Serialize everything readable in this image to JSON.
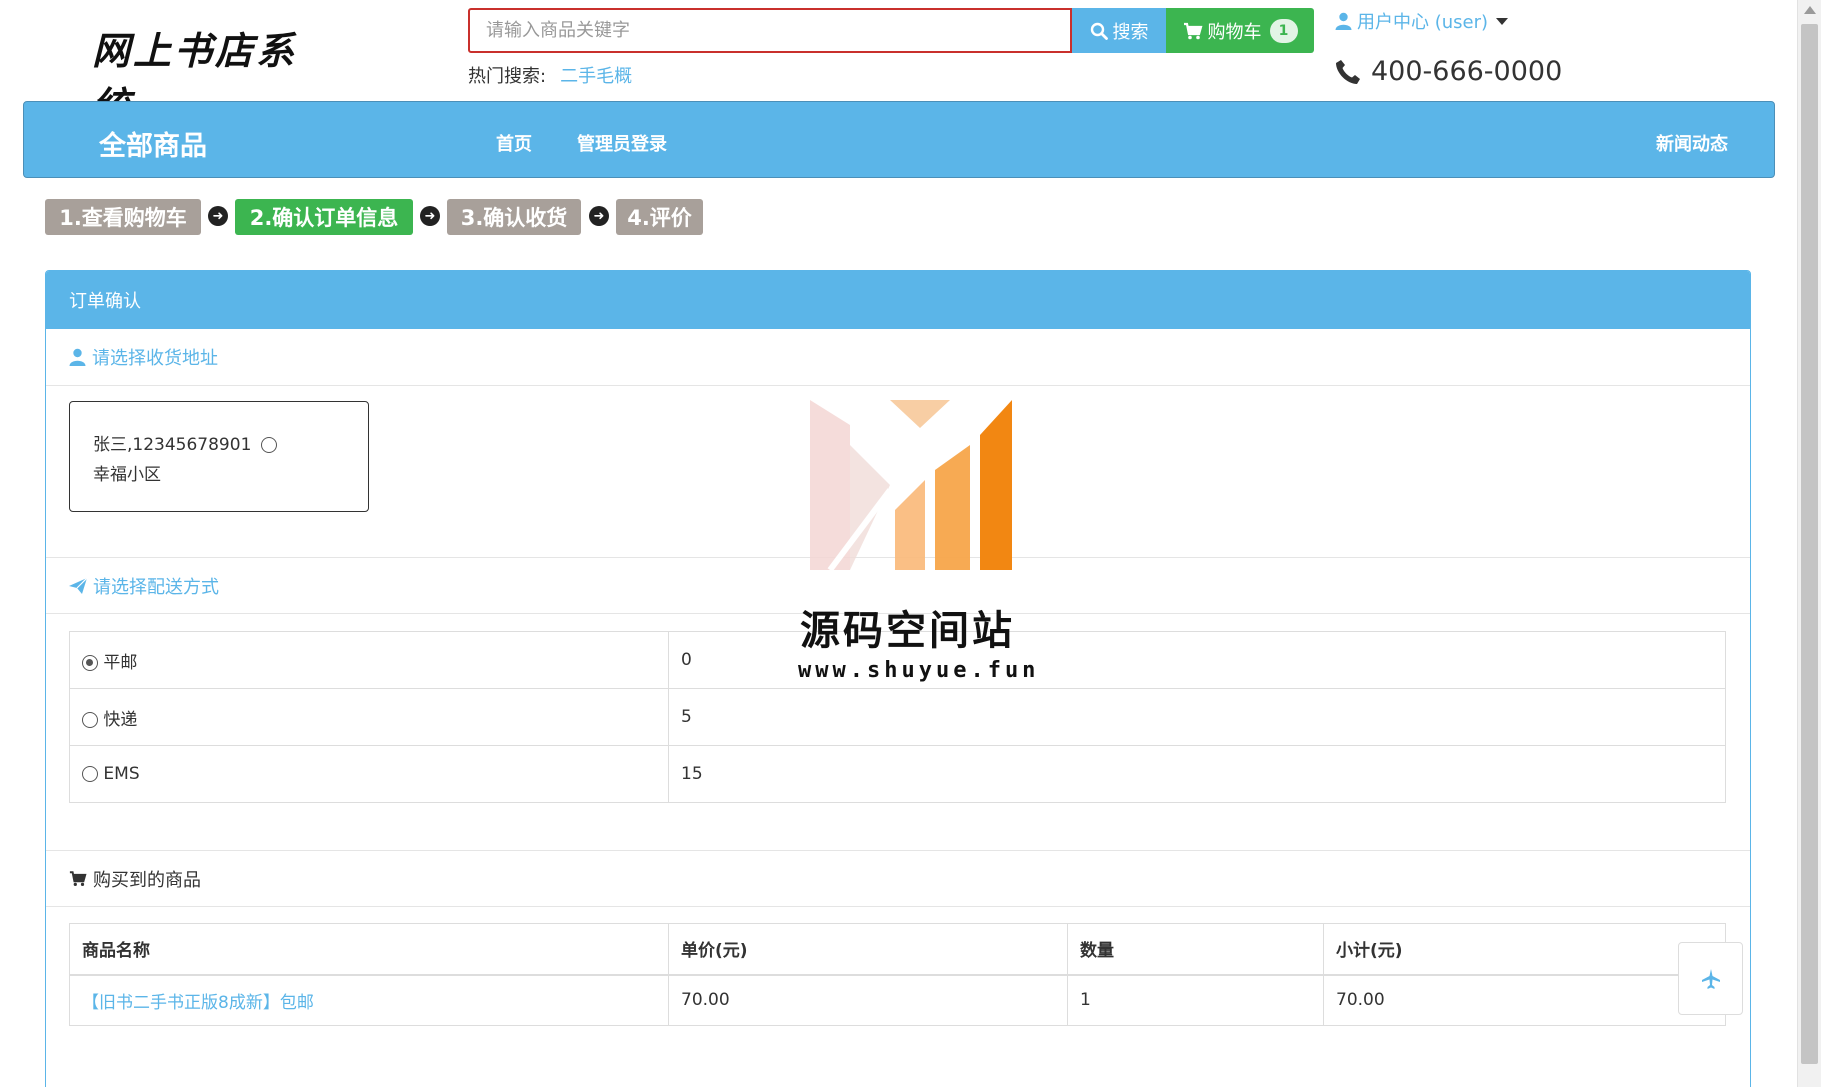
{
  "header": {
    "logo_text": "网上书店系统",
    "search_placeholder": "请输入商品关键字",
    "search_label": "搜索",
    "cart_label": "购物车",
    "cart_count": "1",
    "hot_label": "热门搜索:",
    "hot_items": [
      "二手毛概"
    ],
    "user_center": "用户中心 (user)",
    "phone": "400-666-0000"
  },
  "navbar": {
    "brand": "全部商品",
    "links": [
      "首页",
      "管理员登录"
    ],
    "right_link": "新闻动态"
  },
  "steps": [
    {
      "label": "1.查看购物车",
      "active": false
    },
    {
      "label": "2.确认订单信息",
      "active": true
    },
    {
      "label": "3.确认收货",
      "active": false
    },
    {
      "label": "4.评价",
      "active": false
    }
  ],
  "panel": {
    "title": "订单确认",
    "address_section": "请选择收货地址",
    "address": {
      "line1": "张三,12345678901",
      "line2": "幸福小区"
    },
    "shipping_section": "请选择配送方式",
    "shipping": [
      {
        "name": "平邮",
        "cost": "0",
        "selected": true
      },
      {
        "name": "快递",
        "cost": "5",
        "selected": false
      },
      {
        "name": "EMS",
        "cost": "15",
        "selected": false
      }
    ],
    "goods_section": "购买到的商品",
    "goods_headers": [
      "商品名称",
      "单价(元)",
      "数量",
      "小计(元)"
    ],
    "goods": [
      {
        "name": "【旧书二手书正版8成新】包邮",
        "price": "70.00",
        "qty": "1",
        "subtotal": "70.00"
      }
    ]
  },
  "watermark": {
    "title": "源码空间站",
    "url": "www.shuyue.fun"
  },
  "colors": {
    "accent": "#5bb5e8",
    "green": "#3cb550",
    "step_inactive": "#a8a09a",
    "search_border": "#c9302c"
  }
}
